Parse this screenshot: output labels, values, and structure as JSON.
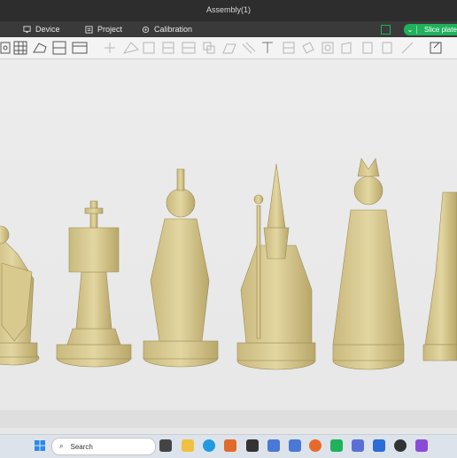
{
  "window": {
    "title": "Assembly(1)"
  },
  "tabs": [
    {
      "label": "Device",
      "icon": "monitor-icon"
    },
    {
      "label": "Project",
      "icon": "project-icon"
    },
    {
      "label": "Calibration",
      "icon": "calibration-icon"
    }
  ],
  "slice_button": {
    "label": "Slice plate"
  },
  "toolbar_icons": [
    "add-object-icon",
    "arrange-icon",
    "orient-icon",
    "split-icon",
    "layout-icon",
    "plate-icon",
    "move-icon",
    "rotate-icon",
    "scale-icon",
    "lay-flat-icon",
    "cut-icon",
    "mesh-boolean-icon",
    "paint-icon",
    "support-paint-icon",
    "text-icon",
    "seam-icon",
    "measure-icon",
    "assembly-icon",
    "variable-layer-icon",
    "brim-ear-icon"
  ],
  "taskbar": {
    "search_placeholder": "Search",
    "icons": [
      "windows-start-icon",
      "task-view-icon",
      "file-explorer-icon",
      "edge-icon",
      "store-icon",
      "app-icon",
      "settings-icon",
      "firefox-icon",
      "bambu-studio-icon",
      "media-icon",
      "app2-icon",
      "app3-icon",
      "app4-icon"
    ]
  },
  "colors": {
    "accent": "#1fb15b",
    "model": "#d9cb95"
  }
}
